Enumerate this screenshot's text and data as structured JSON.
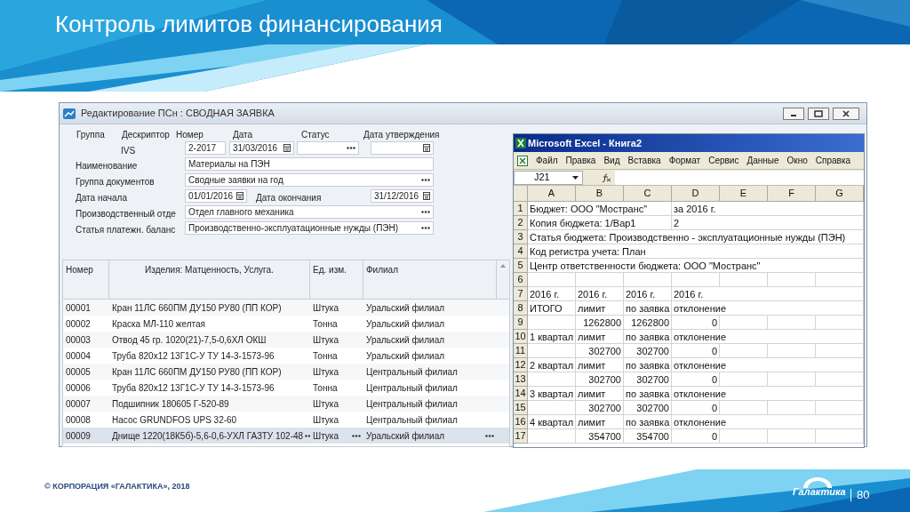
{
  "slide": {
    "title": "Контроль лимитов финансирования",
    "footer": "© КОРПОРАЦИЯ «ГАЛАКТИКА», 2018",
    "logo": "Галактика",
    "page_number": "80"
  },
  "window": {
    "title": "Редактирование ПСн : СВОДНАЯ ЗАЯВКА"
  },
  "header_fields": {
    "labels": [
      "Группа",
      "Дескриптор",
      "Номер",
      "Дата",
      "Статус",
      "Дата утверждения"
    ],
    "descriptor": "IVS",
    "number": "2-2017",
    "date": "31/03/2016"
  },
  "form_rows": [
    {
      "kind": "text",
      "label": "Наименование",
      "value": "Материалы на ПЭН"
    },
    {
      "kind": "picker",
      "label": "Группа документов",
      "value": "Сводные заявки на год"
    },
    {
      "kind": "date_range",
      "label": "Дата начала",
      "value": "01/01/2016",
      "end_label": "Дата окончания",
      "end_value": "31/12/2016"
    },
    {
      "kind": "picker",
      "label": "Производственный отде",
      "value": "Отдел главного механика"
    },
    {
      "kind": "picker",
      "label": "Статья платежн. баланс",
      "value": "Производственно-эксплуатационные нужды (ПЭН)"
    }
  ],
  "table": {
    "columns": [
      "Номер",
      "Изделия: Матценность, Услуга.",
      "Ед. изм.",
      "Филиал"
    ],
    "rows": [
      {
        "cells": [
          "00001",
          "Кран 11ЛС 660ПМ ДУ150 РУ80 (ПП КОР)",
          "Штука",
          "Уральский филиал"
        ],
        "selected": false
      },
      {
        "cells": [
          "00002",
          "Краска МЛ-110 желтая",
          "Тонна",
          "Уральский филиал"
        ],
        "selected": false
      },
      {
        "cells": [
          "00003",
          "Отвод 45 гр. 1020(21)-7,5-0,6ХЛ ОКШ",
          "Штука",
          "Уральский филиал"
        ],
        "selected": false
      },
      {
        "cells": [
          "00004",
          "Труба 820х12 13Г1С-У ТУ 14-3-1573-96",
          "Тонна",
          "Уральский филиал"
        ],
        "selected": false
      },
      {
        "cells": [
          "00005",
          "Кран 11ЛС 660ПМ ДУ150 РУ80 (ПП КОР)",
          "Штука",
          "Центральный филиал"
        ],
        "selected": false
      },
      {
        "cells": [
          "00006",
          "Труба 820х12 13Г1С-У ТУ 14-3-1573-96",
          "Тонна",
          "Центральный филиал"
        ],
        "selected": false
      },
      {
        "cells": [
          "00007",
          "Подшипник 180605 Г-520-89",
          "Штука",
          "Центральный филиал"
        ],
        "selected": false
      },
      {
        "cells": [
          "00008",
          "Насос GRUNDFOS UPS 32-60",
          "Штука",
          "Центральный филиал"
        ],
        "selected": false
      },
      {
        "cells": [
          "00009",
          "Днище 1220(18К5б)-5,6-0,6-УХЛ ГАЗТУ 102-48",
          "Штука",
          "Уральский филиал"
        ],
        "selected": true
      }
    ]
  },
  "excel": {
    "title": "Microsoft Excel - Книга2",
    "menu": [
      "Файл",
      "Правка",
      "Вид",
      "Вставка",
      "Формат",
      "Сервис",
      "Данные",
      "Окно",
      "Справка"
    ],
    "name_box": "J21",
    "columns": [
      "A",
      "B",
      "C",
      "D",
      "E",
      "F",
      "G"
    ],
    "rows": [
      {
        "number": "1",
        "kind": "text",
        "cells": [
          "Бюджет: ООО \"Мостранс\"",
          "",
          "",
          "за 2016 г."
        ]
      },
      {
        "number": "2",
        "kind": "text",
        "cells": [
          "Копия бюджета: 1/Вар1",
          "",
          "",
          "2"
        ]
      },
      {
        "number": "3",
        "kind": "text",
        "cells": [
          "Статья бюджета: Производственно - эксплуатационные нужды (ПЭН)"
        ]
      },
      {
        "number": "4",
        "kind": "text",
        "cells": [
          "Код регистра учета: План"
        ]
      },
      {
        "number": "5",
        "kind": "text",
        "cells": [
          "Центр ответственности бюджета: ООО \"Мостранс\""
        ]
      },
      {
        "number": "6",
        "kind": "text"
      },
      {
        "number": "7",
        "kind": "text",
        "cells": [
          "2016 г.",
          "2016 г.",
          "2016 г.",
          "2016 г."
        ]
      },
      {
        "number": "8",
        "kind": "text",
        "cells": [
          "ИТОГО",
          "лимит",
          "по заявка",
          "отклонение"
        ]
      },
      {
        "number": "9",
        "kind": "numbers",
        "cells": [
          "",
          "1262800",
          "1262800",
          "0"
        ]
      },
      {
        "number": "10",
        "kind": "text",
        "cells": [
          "1 квартал",
          "лимит",
          "по заявка",
          "отклонение"
        ]
      },
      {
        "number": "11",
        "kind": "numbers",
        "cells": [
          "",
          "302700",
          "302700",
          "0"
        ]
      },
      {
        "number": "12",
        "kind": "text",
        "cells": [
          "2 квартал",
          "лимит",
          "по заявка",
          "отклонение"
        ]
      },
      {
        "number": "13",
        "kind": "numbers",
        "cells": [
          "",
          "302700",
          "302700",
          "0"
        ]
      },
      {
        "number": "14",
        "kind": "text",
        "cells": [
          "3 квартал",
          "лимит",
          "по заявка",
          "отклонение"
        ]
      },
      {
        "number": "15",
        "kind": "numbers",
        "cells": [
          "",
          "302700",
          "302700",
          "0"
        ]
      },
      {
        "number": "16",
        "kind": "text",
        "cells": [
          "4 квартал",
          "лимит",
          "по заявка",
          "отклонение"
        ]
      },
      {
        "number": "17",
        "kind": "numbers",
        "cells": [
          "",
          "354700",
          "354700",
          "0"
        ]
      }
    ]
  }
}
